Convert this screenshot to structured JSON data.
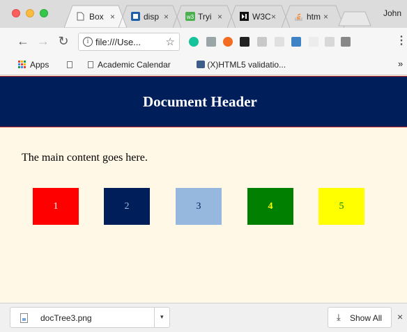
{
  "browser": {
    "tabs": [
      {
        "title": "Box",
        "icon": "document-icon",
        "active": true
      },
      {
        "title": "disp",
        "icon": "codepen-icon"
      },
      {
        "title": "Tryi",
        "icon": "w3schools-icon"
      },
      {
        "title": "W3C",
        "icon": "w3c-icon"
      },
      {
        "title": "htm",
        "icon": "stackoverflow-icon"
      }
    ],
    "tab_close": "×",
    "profile_name": "John",
    "address": "file:///Use...",
    "menu": "⋮"
  },
  "bookmarks": {
    "apps": "Apps",
    "items": [
      {
        "label": "Academic Calendar",
        "icon": "document-icon"
      },
      {
        "label": "(X)HTML5 validatio...",
        "icon": "validator-icon"
      }
    ],
    "overflow": "»"
  },
  "page": {
    "header": "Document Header",
    "main_text": "The main content goes here.",
    "boxes": [
      {
        "label": "1",
        "bg": "#ff0000",
        "fg": "#ffffff"
      },
      {
        "label": "2",
        "bg": "#001e5a",
        "fg": "#9db8dd"
      },
      {
        "label": "3",
        "bg": "#97b8de",
        "fg": "#001e5a"
      },
      {
        "label": "4",
        "bg": "#007f00",
        "fg": "#ffff00"
      },
      {
        "label": "5",
        "bg": "#ffff00",
        "fg": "#007f00"
      }
    ]
  },
  "downloads": {
    "file": "docTree3.png",
    "show_all": "Show All",
    "close": "×"
  },
  "colors": {
    "header_bg": "#001e5a",
    "header_border": "#c8332b",
    "page_bg": "#fff8e6"
  }
}
